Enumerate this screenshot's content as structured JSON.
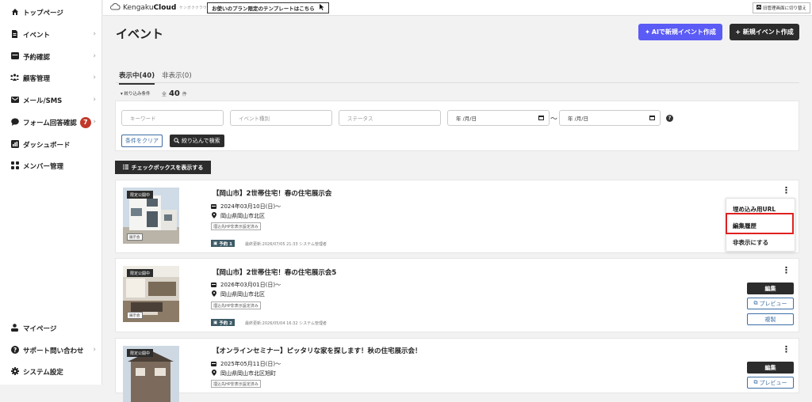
{
  "sidebar": {
    "items": [
      {
        "label": "トップページ",
        "icon": "home-icon",
        "chevron": false
      },
      {
        "label": "イベント",
        "icon": "document-icon",
        "chevron": true
      },
      {
        "label": "予約確認",
        "icon": "list-icon",
        "chevron": true
      },
      {
        "label": "顧客管理",
        "icon": "people-icon",
        "chevron": true
      },
      {
        "label": "メール/SMS",
        "icon": "mail-icon",
        "chevron": true
      },
      {
        "label": "フォーム回答確認",
        "icon": "chat-icon",
        "chevron": true,
        "badge": "7"
      },
      {
        "label": "ダッシュボード",
        "icon": "chart-icon",
        "chevron": false
      },
      {
        "label": "メンバー管理",
        "icon": "grid-icon",
        "chevron": false
      }
    ],
    "bottom": [
      {
        "label": "マイページ",
        "icon": "user-icon",
        "chevron": false
      },
      {
        "label": "サポート問い合わせ",
        "icon": "help-icon",
        "chevron": true
      },
      {
        "label": "システム設定",
        "icon": "gear-icon",
        "chevron": false
      }
    ]
  },
  "topbar": {
    "logo_name_light": "Kengaku",
    "logo_name_bold": "Cloud",
    "logo_tagline": "ケンガククラウド",
    "template_link": "お使いのプラン限定のテンプレートはこちら",
    "switch_label": "旧管理画面に切り替え"
  },
  "page": {
    "title": "イベント",
    "ai_button": "AIで新規イベント作成",
    "new_button": "+ 新規イベント作成"
  },
  "tabs": [
    {
      "label": "表示中(40)",
      "active": true
    },
    {
      "label": "非表示(0)",
      "active": false
    }
  ],
  "filter": {
    "header": "▾ 絞り込み条件",
    "count_prefix": "全",
    "count": "40",
    "count_suffix": "件",
    "keyword_placeholder": "キーワード",
    "type_placeholder": "イベント種別",
    "status_placeholder": "ステータス",
    "date_placeholder": "年 /月/日",
    "range_sep": "〜",
    "clear_button": "条件をクリア",
    "search_button": "絞り込んで検索"
  },
  "checkbox_button": "チェックボックスを表示する",
  "events": [
    {
      "ribbon": "限定公開中",
      "type_tag": "展示会",
      "title": "【岡山市】2世帯住宅！春の住宅展示会",
      "date": "2024年03月10日(日)〜",
      "location": "岡山県岡山市北区",
      "hp_tag": "埋込先HP非表示設定済み",
      "reservations": "予約 1",
      "updated": "最終更新:2026/07/05 21:33 システム管理者"
    },
    {
      "ribbon": "限定公開中",
      "type_tag": "展示会",
      "title": "【岡山市】2世帯住宅！春の住宅展示会5",
      "date": "2026年03月01日(日)〜",
      "location": "岡山県岡山市北区",
      "hp_tag": "埋込先HP非表示設定済み",
      "reservations": "予約 2",
      "updated": "最終更新:2026/05/04 16:32 システム管理者"
    },
    {
      "ribbon": "限定公開中",
      "type_tag": "展示会",
      "title": "【オンラインセミナー】ピッタリな家を探します！秋の住宅展示会！",
      "date": "2025年05月11日(日)〜",
      "location": "岡山県岡山市北区旭町",
      "hp_tag": "埋込先HP非表示設定済み",
      "reservations": "",
      "updated": ""
    }
  ],
  "menu": {
    "embed_url": "埋め込み用URL",
    "history": "編集履歴",
    "hide": "非表示にする"
  },
  "actions": {
    "edit": "編集",
    "preview": "プレビュー",
    "duplicate": "複製"
  },
  "colors": {
    "ai_button": "#5b5bf5",
    "dark": "#2c2c2c",
    "badge": "#c0392b",
    "highlight": "#e02020",
    "link_blue": "#3b6ea5"
  }
}
